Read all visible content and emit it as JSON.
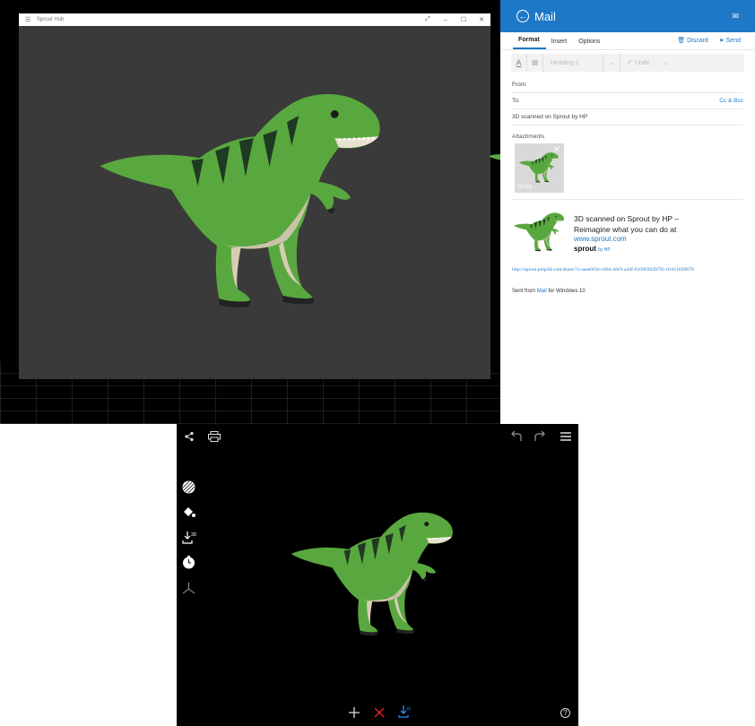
{
  "hub": {
    "title": "Sprout Hub",
    "menu_icon": "hamburger-icon",
    "window_buttons": [
      "⤢",
      "–",
      "☐",
      "✕"
    ]
  },
  "mail": {
    "title": "Mail",
    "tabs": [
      {
        "label": "Format",
        "active": true
      },
      {
        "label": "Insert",
        "active": false
      },
      {
        "label": "Options",
        "active": false
      }
    ],
    "discard_label": "Discard",
    "send_label": "Send",
    "heading_placeholder": "Heading 1",
    "undo_label": "Undo",
    "from_label": "From:",
    "to_label": "To:",
    "cc_bcc_label": "Cc & Bcc",
    "subject": "3D scanned on Sprout by HP",
    "attachments_label": "Attachments",
    "attachment_size": "293 KB",
    "card_title": "3D scanned on Sprout by HP – Reimagine what you can do at",
    "card_url": "www.sprout.com",
    "card_brand": "sprout",
    "card_brand_suffix": "by HP",
    "share_url": "http://sprout.prep3d.com/share/?1-aaee6f1b-c664-4dc9-a44f-610903039791-01611839679",
    "sent_prefix": "Sent from ",
    "sent_app": "Mail",
    "sent_suffix": " for Windows 10",
    "accent_color": "#1e78c8"
  },
  "viewer": {
    "top_icons": [
      "share-icon",
      "print-icon",
      "undo-icon",
      "redo-icon",
      "menu-icon"
    ],
    "side_icons": [
      "texture-icon",
      "paint-bucket-icon",
      "export-3d-icon",
      "timer-icon",
      "axes-icon"
    ],
    "bottom_icons": [
      "add-icon",
      "delete-icon",
      "save-3d-icon"
    ],
    "help_label": "?",
    "delete_color": "#e02020",
    "save_color": "#2a8ef0"
  }
}
